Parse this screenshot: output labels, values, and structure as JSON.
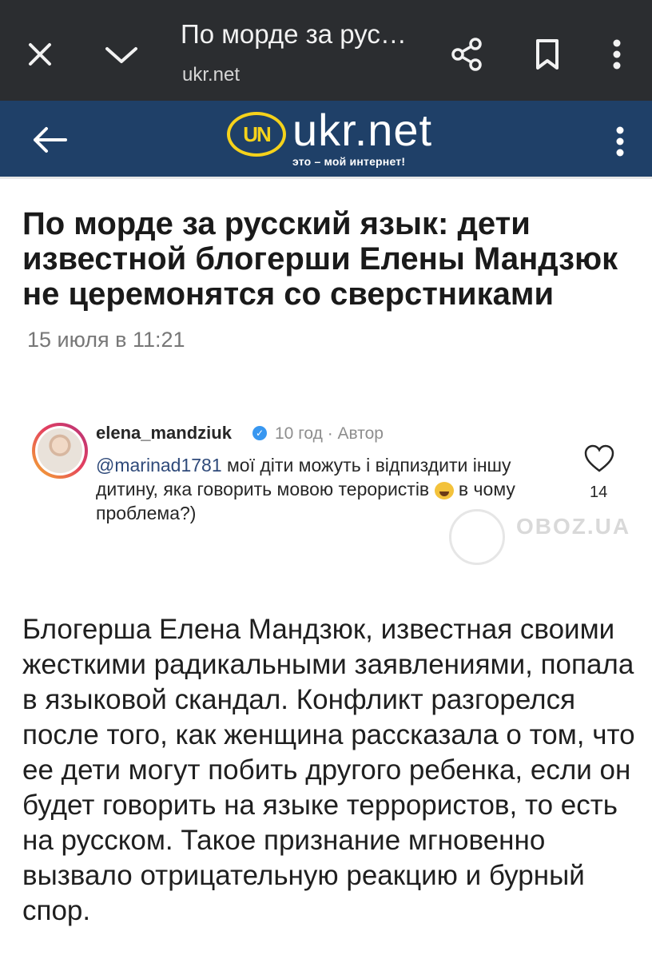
{
  "browser": {
    "tab_title": "По морде за рус…",
    "url": "ukr.net"
  },
  "site": {
    "logo_mark": "UN",
    "logo_text": "ukr.net",
    "tagline": "это – мой интернет!"
  },
  "article": {
    "headline": "По морде за русский язык: дети известной блогерши Елены Мандзюк не церемонятся со сверстниками",
    "date": "15 июля в 11:21",
    "comment": {
      "username": "elena_mandziuk",
      "meta": "10 год · Автор",
      "mention": "@marinad1781",
      "text_part1": " мої діти можуть і відпиздити іншу дитину, яка говорить мовою терористів ",
      "text_part2": " в чому проблема?)",
      "likes": "14",
      "watermark": "OBOZ.UA"
    },
    "body": "Блогерша Елена Мандзюк, известная своими жесткими радикальными заявлениями, попала в языковой скандал. Конфликт разгорелся после того, как женщина рассказала о том, что ее дети могут побить другого ребенка, если он будет говорить на языке террористов, то есть на русском. Такое признание мгновенно вызвало отрицательную реакцию и бурный спор."
  },
  "icons": [
    "close-icon",
    "chevron-down-icon",
    "share-icon",
    "bookmark-icon",
    "more-vert-icon",
    "back-arrow-icon",
    "heart-icon",
    "laughing-emoji-icon",
    "verified-icon"
  ],
  "colors": {
    "browser_bar": "#2b2d30",
    "site_header": "#1f4068",
    "logo_accent": "#f5d21b"
  }
}
